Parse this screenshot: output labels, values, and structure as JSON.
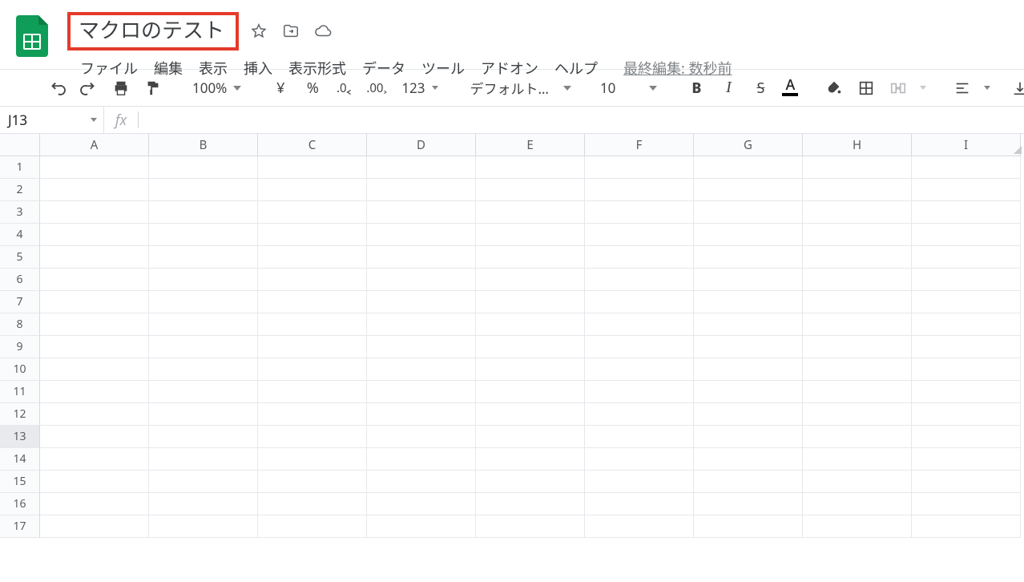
{
  "header": {
    "doc_title": "マクロのテスト",
    "star_tooltip": "star-icon",
    "move_tooltip": "move-to-folder-icon",
    "cloud_tooltip": "cloud-saved-icon",
    "menus": [
      "ファイル",
      "編集",
      "表示",
      "挿入",
      "表示形式",
      "データ",
      "ツール",
      "アドオン",
      "ヘルプ"
    ],
    "last_edit": "最終編集: 数秒前"
  },
  "toolbar": {
    "zoom": "100%",
    "currency_symbol": "¥",
    "percent_symbol": "%",
    "decrease_dec": ".0",
    "increase_dec": ".00",
    "number_format": "123",
    "font_name": "デフォルト…",
    "font_size": "10",
    "bold": "B",
    "italic": "I",
    "strike": "S",
    "textcolor_letter": "A"
  },
  "fxbar": {
    "active_cell": "J13",
    "fx_label": "fx",
    "formula_value": ""
  },
  "grid": {
    "columns": [
      "A",
      "B",
      "C",
      "D",
      "E",
      "F",
      "G",
      "H",
      "I"
    ],
    "rows": [
      1,
      2,
      3,
      4,
      5,
      6,
      7,
      8,
      9,
      10,
      11,
      12,
      13,
      14,
      15,
      16,
      17
    ],
    "selected_row": 13
  }
}
